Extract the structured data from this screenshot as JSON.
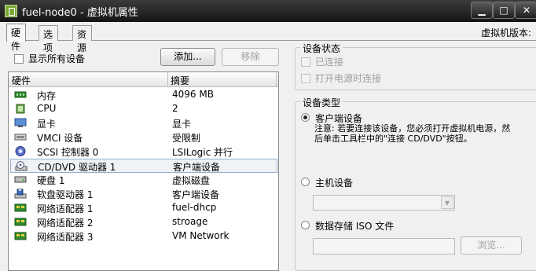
{
  "window": {
    "title": "fuel-node0 - 虚拟机属性"
  },
  "window_controls": {
    "minimize": "▁",
    "maximize": "□",
    "close": "✕"
  },
  "tabs": [
    {
      "label": "硬件"
    },
    {
      "label": "选项"
    },
    {
      "label": "资源"
    }
  ],
  "version_label": "虚拟机版本:",
  "show_all_label": "显示所有设备",
  "add_label": "添加...",
  "remove_label": "移除",
  "columns": {
    "hardware": "硬件",
    "summary": "摘要"
  },
  "hardware": [
    {
      "name": "内存",
      "summary": "4096 MB",
      "icon": "memory-icon"
    },
    {
      "name": "CPU",
      "summary": "2",
      "icon": "cpu-icon"
    },
    {
      "name": "显卡",
      "summary": "显卡",
      "icon": "display-icon"
    },
    {
      "name": "VMCI 设备",
      "summary": "受限制",
      "icon": "vmci-icon"
    },
    {
      "name": "SCSI 控制器 0",
      "summary": "LSILogic 并行",
      "icon": "scsi-icon"
    },
    {
      "name": "CD/DVD 驱动器 1",
      "summary": "客户端设备",
      "icon": "cdrom-icon",
      "selected": true
    },
    {
      "name": "硬盘 1",
      "summary": "虚拟磁盘",
      "icon": "disk-icon"
    },
    {
      "name": "软盘驱动器 1",
      "summary": "客户端设备",
      "icon": "floppy-icon"
    },
    {
      "name": "网络适配器 1",
      "summary": "fuel-dhcp",
      "icon": "network-icon"
    },
    {
      "name": "网络适配器 2",
      "summary": "stroage",
      "icon": "network-icon"
    },
    {
      "name": "网络适配器 3",
      "summary": "VM Network",
      "icon": "network-icon"
    }
  ],
  "device_status": {
    "title": "设备状态",
    "connected": "已连接",
    "connect_at_power_on": "打开电源时连接"
  },
  "device_type": {
    "title": "设备类型",
    "client_device": "客户端设备",
    "note": "注意: 若要连接该设备，您必须打开虚拟机电源，然后单击工具栏中的\"连接 CD/DVD\"按钮。",
    "host_device": "主机设备",
    "host_select_value": "",
    "iso_file": "数据存储 ISO 文件",
    "iso_path_value": "",
    "browse_label": "浏览..."
  }
}
